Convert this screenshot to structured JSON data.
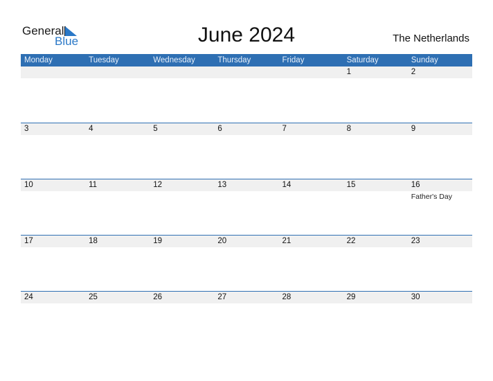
{
  "logo": {
    "word1": "General",
    "word2": "Blue"
  },
  "title": "June 2024",
  "country": "The Netherlands",
  "colors": {
    "accent": "#2e6fb3",
    "strip": "#f0f0f0"
  },
  "weekdays": [
    "Monday",
    "Tuesday",
    "Wednesday",
    "Thursday",
    "Friday",
    "Saturday",
    "Sunday"
  ],
  "weeks": [
    {
      "days": [
        "",
        "",
        "",
        "",
        "",
        "1",
        "2"
      ],
      "events": [
        "",
        "",
        "",
        "",
        "",
        "",
        ""
      ]
    },
    {
      "days": [
        "3",
        "4",
        "5",
        "6",
        "7",
        "8",
        "9"
      ],
      "events": [
        "",
        "",
        "",
        "",
        "",
        "",
        ""
      ]
    },
    {
      "days": [
        "10",
        "11",
        "12",
        "13",
        "14",
        "15",
        "16"
      ],
      "events": [
        "",
        "",
        "",
        "",
        "",
        "",
        "Father's Day"
      ]
    },
    {
      "days": [
        "17",
        "18",
        "19",
        "20",
        "21",
        "22",
        "23"
      ],
      "events": [
        "",
        "",
        "",
        "",
        "",
        "",
        ""
      ]
    },
    {
      "days": [
        "24",
        "25",
        "26",
        "27",
        "28",
        "29",
        "30"
      ],
      "events": [
        "",
        "",
        "",
        "",
        "",
        "",
        ""
      ]
    }
  ]
}
